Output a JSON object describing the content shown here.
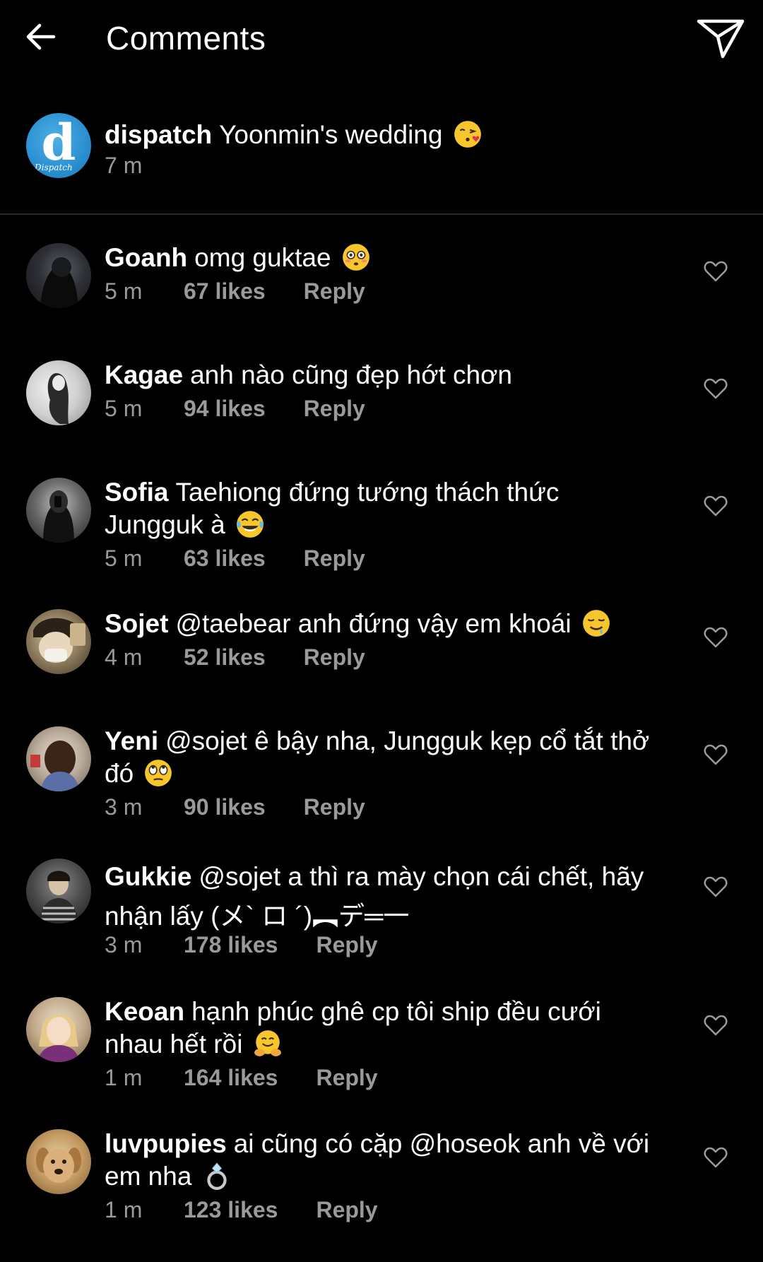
{
  "header": {
    "title": "Comments",
    "back_icon": "arrow-left-icon",
    "send_icon": "paper-plane-icon"
  },
  "caption": {
    "username": "dispatch",
    "text": "Yoonmin's wedding",
    "emoji": "face-blowing-kiss",
    "time": "7 m",
    "avatar_letter": "d",
    "avatar_sub": "Dispatch"
  },
  "comments": [
    {
      "username": "Goanh",
      "text": "omg guktae",
      "emoji": "flushed-face",
      "time": "5 m",
      "likes": "67 likes",
      "reply": "Reply"
    },
    {
      "username": "Kagae",
      "text": "anh nào cũng đẹp hớt chơn",
      "emoji": "",
      "time": "5 m",
      "likes": "94 likes",
      "reply": "Reply"
    },
    {
      "username": "Sofia",
      "text": "Taehiong đứng tướng thách thức Jungguk à",
      "emoji": "tears-of-joy",
      "time": "5 m",
      "likes": "63 likes",
      "reply": "Reply"
    },
    {
      "username": "Sojet",
      "text": "@taebear anh đứng vậy em khoái",
      "emoji": "drooling-face",
      "time": "4 m",
      "likes": "52 likes",
      "reply": "Reply"
    },
    {
      "username": "Yeni",
      "text": "@sojet ê bậy nha, Jungguk kẹp cổ tắt thở đó",
      "emoji": "eye-roll-face",
      "time": "3 m",
      "likes": "90 likes",
      "reply": "Reply"
    },
    {
      "username": "Gukkie",
      "text": "@sojet a thì ra mày chọn cái chết, hãy nhận lấy (メ` ロ ´)︻デ═一",
      "emoji": "",
      "time": "3 m",
      "likes": "178 likes",
      "reply": "Reply"
    },
    {
      "username": "Keoan",
      "text": "hạnh phúc ghê cp tôi ship đều cưới nhau hết rồi",
      "emoji": "hugging-face",
      "time": "1 m",
      "likes": "164 likes",
      "reply": "Reply"
    },
    {
      "username": "luvpupies",
      "text": "ai cũng có cặp @hoseok anh về với em nha",
      "emoji": "ring",
      "time": "1 m",
      "likes": "123 likes",
      "reply": "Reply"
    }
  ],
  "colors": {
    "background": "#000000",
    "text": "#ffffff",
    "secondary": "#9a9a9a",
    "divider": "#2a2a2a",
    "emoji_yellow": "#f7c52c",
    "dispatch_blue": "#2a8fd0"
  }
}
